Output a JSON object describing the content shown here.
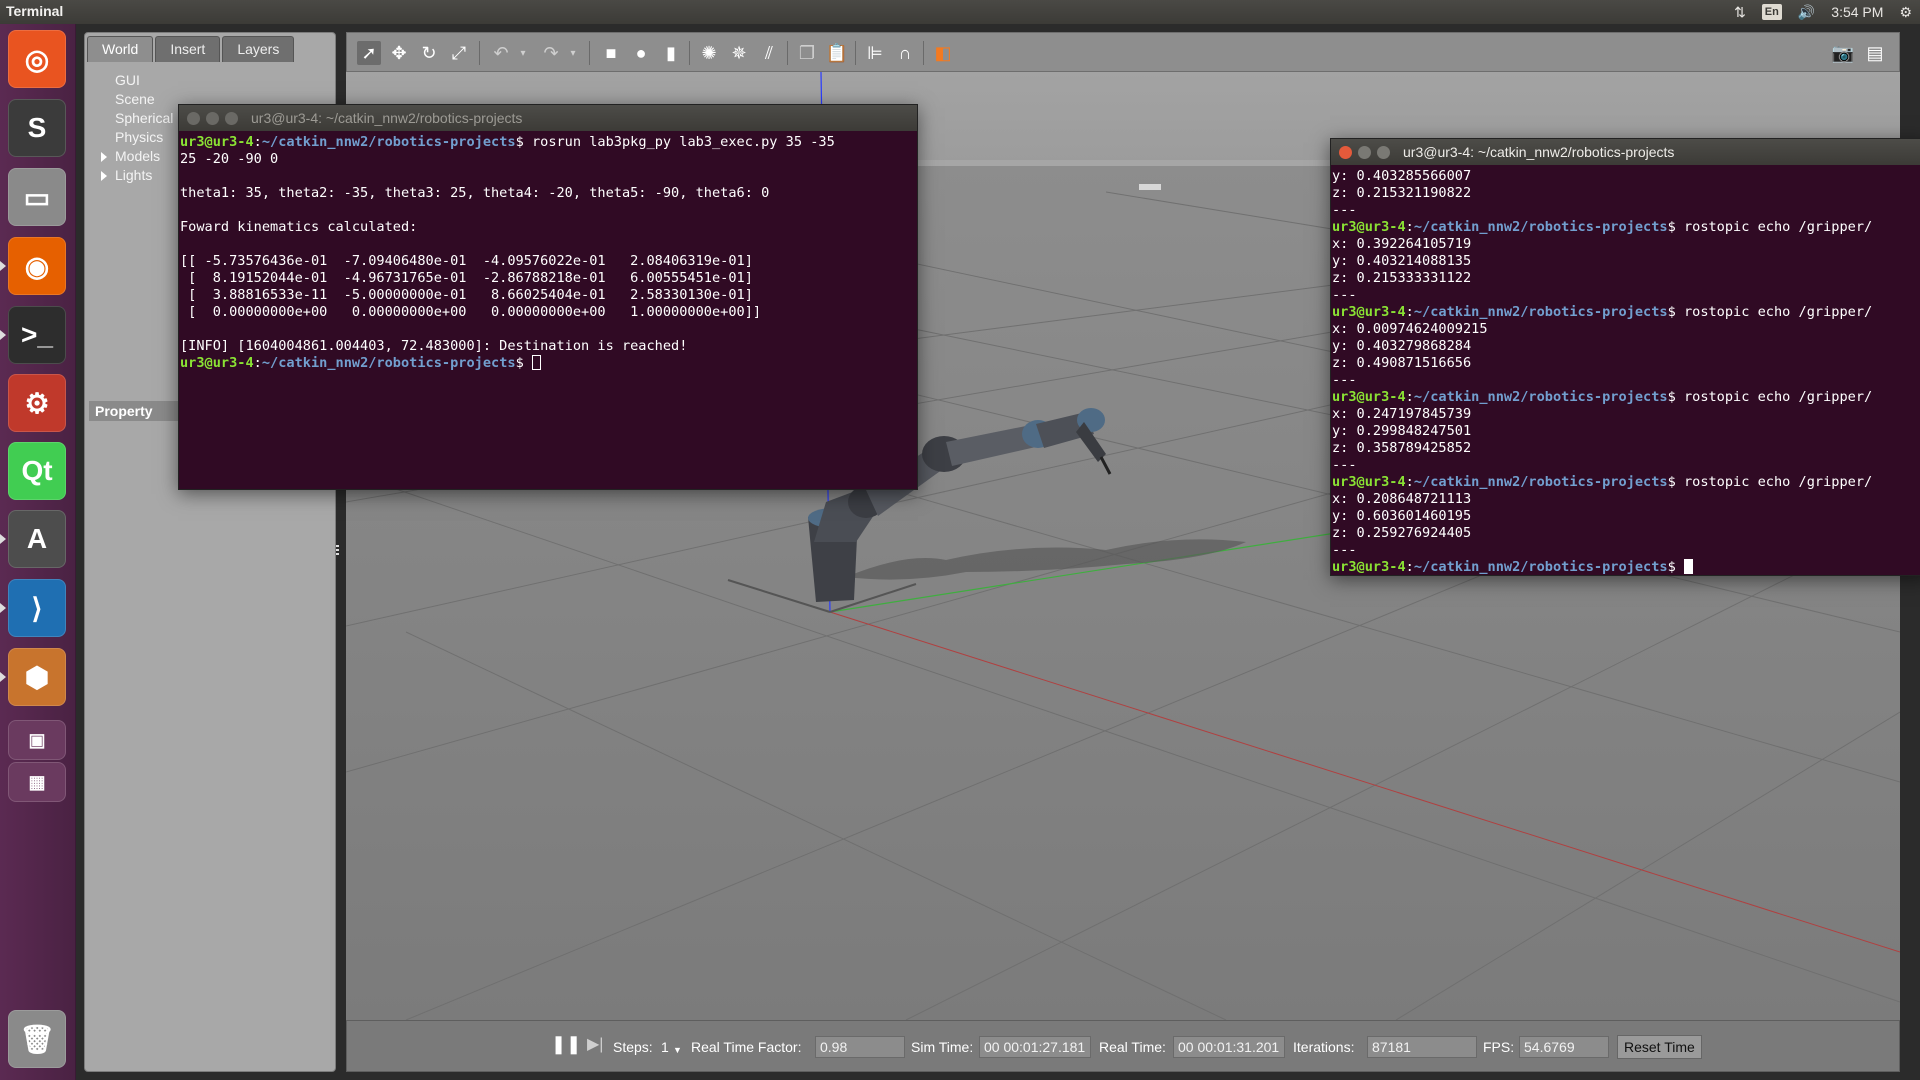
{
  "top_panel": {
    "app_title": "Terminal",
    "keyboard_lang": "En",
    "clock": "3:54 PM"
  },
  "launcher": {
    "icons": [
      {
        "name": "ubuntu-dash-icon",
        "glyph": "◎",
        "bg": "#e95420"
      },
      {
        "name": "sublime-text-icon",
        "glyph": "S",
        "bg": "#3b3b3b"
      },
      {
        "name": "files-icon",
        "glyph": "▭",
        "bg": "#8a8a8a"
      },
      {
        "name": "firefox-icon",
        "glyph": "◉",
        "bg": "#e66000"
      },
      {
        "name": "terminal-icon",
        "glyph": ">_",
        "bg": "#2d2d2d"
      },
      {
        "name": "system-settings-icon",
        "glyph": "⚙",
        "bg": "#c0392b"
      },
      {
        "name": "qt-creator-icon",
        "glyph": "Qt",
        "bg": "#41cd52"
      },
      {
        "name": "software-updater-icon",
        "glyph": "A",
        "bg": "#4d4d4d"
      },
      {
        "name": "vscode-icon",
        "glyph": "⟩",
        "bg": "#1f6fb2"
      },
      {
        "name": "gazebo-icon",
        "glyph": "⬢",
        "bg": "#c8742d"
      },
      {
        "name": "screenshot-icon",
        "glyph": "▣",
        "bg": "#6a3a5f"
      },
      {
        "name": "workspace-switcher-icon",
        "glyph": "▦",
        "bg": "#6a3a5f"
      },
      {
        "name": "trash-icon",
        "glyph": "🗑",
        "bg": "#8a8a8a"
      }
    ]
  },
  "gazebo": {
    "tabs": [
      "World",
      "Insert",
      "Layers"
    ],
    "world_tree": [
      {
        "label": "GUI",
        "expandable": false
      },
      {
        "label": "Scene",
        "expandable": false
      },
      {
        "label": "Spherical Coordinates",
        "expandable": false
      },
      {
        "label": "Physics",
        "expandable": false
      },
      {
        "label": "Models",
        "expandable": true
      },
      {
        "label": "Lights",
        "expandable": true
      }
    ],
    "property_header": "Property",
    "bottom": {
      "steps_label": "Steps:",
      "steps_value": "1",
      "rtf_label": "Real Time Factor:",
      "rtf_value": "0.98",
      "sim_time_label": "Sim Time:",
      "sim_time_value": "00 00:01:27.181",
      "real_time_label": "Real Time:",
      "real_time_value": "00 00:01:31.201",
      "iterations_label": "Iterations:",
      "iterations_value": "87181",
      "fps_label": "FPS:",
      "fps_value": "54.6769",
      "reset_label": "Reset Time"
    }
  },
  "terminal1": {
    "title": "ur3@ur3-4: ~/catkin_nnw2/robotics-projects",
    "lines": [
      {
        "user": "ur3@ur3-4",
        "path": "~/catkin_nnw2/robotics-projects",
        "cmd": " rosrun lab3pkg_py lab3_exec.py 35 -35"
      },
      {
        "text": "25 -20 -90 0"
      },
      {
        "text": ""
      },
      {
        "text": "theta1: 35, theta2: -35, theta3: 25, theta4: -20, theta5: -90, theta6: 0"
      },
      {
        "text": ""
      },
      {
        "text": "Foward kinematics calculated:"
      },
      {
        "text": ""
      },
      {
        "text": "[[ -5.73576436e-01  -7.09406480e-01  -4.09576022e-01   2.08406319e-01]"
      },
      {
        "text": " [  8.19152044e-01  -4.96731765e-01  -2.86788218e-01   6.00555451e-01]"
      },
      {
        "text": " [  3.88816533e-11  -5.00000000e-01   8.66025404e-01   2.58330130e-01]"
      },
      {
        "text": " [  0.00000000e+00   0.00000000e+00   0.00000000e+00   1.00000000e+00]]"
      },
      {
        "text": ""
      },
      {
        "text": "[INFO] [1604004861.004403, 72.483000]: Destination is reached!"
      },
      {
        "user": "ur3@ur3-4",
        "path": "~/catkin_nnw2/robotics-projects",
        "cmd": " ",
        "cursor": "hollow"
      }
    ]
  },
  "terminal2": {
    "title": "ur3@ur3-4: ~/catkin_nnw2/robotics-projects",
    "lines": [
      {
        "text": "y: 0.403285566007"
      },
      {
        "text": "z: 0.215321190822"
      },
      {
        "text": "---"
      },
      {
        "user": "ur3@ur3-4",
        "path": "~/catkin_nnw2/robotics-projects",
        "cmd": " rostopic echo /gripper/"
      },
      {
        "text": "x: 0.392264105719"
      },
      {
        "text": "y: 0.403214088135"
      },
      {
        "text": "z: 0.215333331122"
      },
      {
        "text": "---"
      },
      {
        "user": "ur3@ur3-4",
        "path": "~/catkin_nnw2/robotics-projects",
        "cmd": " rostopic echo /gripper/"
      },
      {
        "text": "x: 0.00974624009215"
      },
      {
        "text": "y: 0.403279868284"
      },
      {
        "text": "z: 0.490871516656"
      },
      {
        "text": "---"
      },
      {
        "user": "ur3@ur3-4",
        "path": "~/catkin_nnw2/robotics-projects",
        "cmd": " rostopic echo /gripper/"
      },
      {
        "text": "x: 0.247197845739"
      },
      {
        "text": "y: 0.299848247501"
      },
      {
        "text": "z: 0.358789425852"
      },
      {
        "text": "---"
      },
      {
        "user": "ur3@ur3-4",
        "path": "~/catkin_nnw2/robotics-projects",
        "cmd": " rostopic echo /gripper/"
      },
      {
        "text": "x: 0.208648721113"
      },
      {
        "text": "y: 0.603601460195"
      },
      {
        "text": "z: 0.259276924405"
      },
      {
        "text": "---"
      },
      {
        "user": "ur3@ur3-4",
        "path": "~/catkin_nnw2/robotics-projects",
        "cmd": " ",
        "cursor": "solid"
      }
    ]
  }
}
